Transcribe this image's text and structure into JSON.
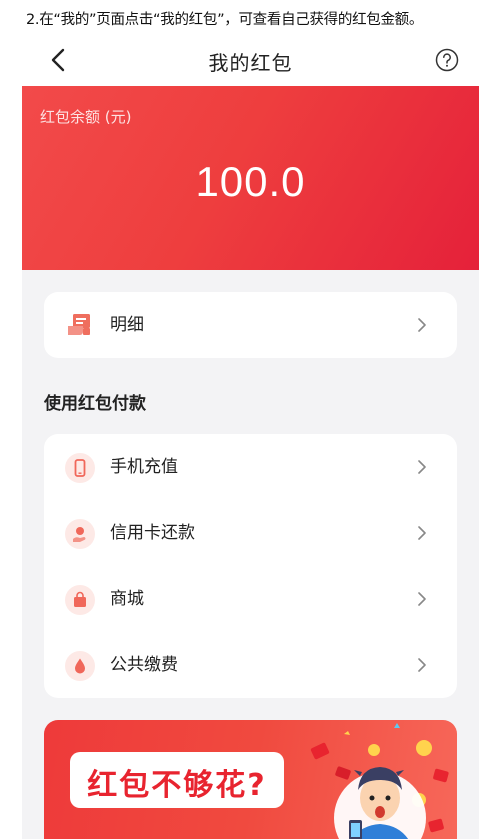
{
  "instruction": "2.在“我的”页面点击“我的红包”，可查看自己获得的红包金额。",
  "navbar": {
    "title": "我的红包",
    "back_icon": "chevron-left-icon",
    "help_icon": "question-circle-icon"
  },
  "balance": {
    "label": "红包余额 (元)",
    "amount": "100.0"
  },
  "detail": {
    "label": "明细",
    "icon": "receipt-icon"
  },
  "section": {
    "title": "使用红包付款"
  },
  "pay_items": [
    {
      "label": "手机充值",
      "icon": "phone-icon"
    },
    {
      "label": "信用卡还款",
      "icon": "person-hand-icon"
    },
    {
      "label": "商城",
      "icon": "shopping-bag-icon"
    },
    {
      "label": "公共缴费",
      "icon": "water-drop-icon"
    }
  ],
  "banner": {
    "text": "红包不够花?"
  },
  "colors": {
    "accent": "#ee3e3e",
    "banner": "#f04a3f",
    "icon_bg": "#fde9e6",
    "icon": "#f0675a",
    "page_bg": "#f3f3f5"
  }
}
